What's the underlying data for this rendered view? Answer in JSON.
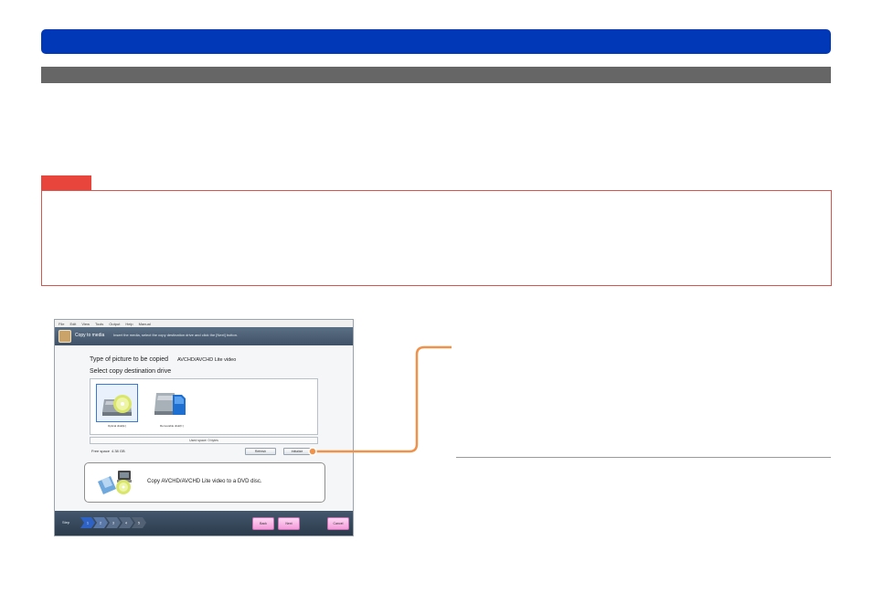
{
  "colors": {
    "title_bar": "#0038b8",
    "section_bar": "#666666",
    "note_accent": "#e8453c",
    "callout": "#f0924a"
  },
  "app": {
    "menu": [
      "File",
      "Edit",
      "View",
      "Tools",
      "Output",
      "Help",
      "Manual"
    ],
    "header_title": "Copy to media",
    "header_instruction": "Insert the media, select the copy destination drive and click the [Next] button.",
    "type_label": "Type of picture to be copied",
    "type_value": "AVCHD/AVCHD Lite video",
    "select_label": "Select copy destination drive",
    "drives": [
      {
        "label": "Optical disk(E:)",
        "icon": "dvd-drive-icon"
      },
      {
        "label": "Removable disk(F:)",
        "icon": "sd-card-icon"
      }
    ],
    "used_space": "Used space: 0 bytes",
    "free_space_label": "Free space",
    "free_space_value": "4.38 GB",
    "refresh_label": "Refresh",
    "initialize_label": "Initialize",
    "description": "Copy AVCHD/AVCHD Lite video to a DVD disc.",
    "step_label": "Step",
    "steps": [
      "1",
      "2",
      "3",
      "4",
      "5"
    ],
    "back_label": "Back",
    "next_label": "Next",
    "cancel_label": "Cancel"
  }
}
